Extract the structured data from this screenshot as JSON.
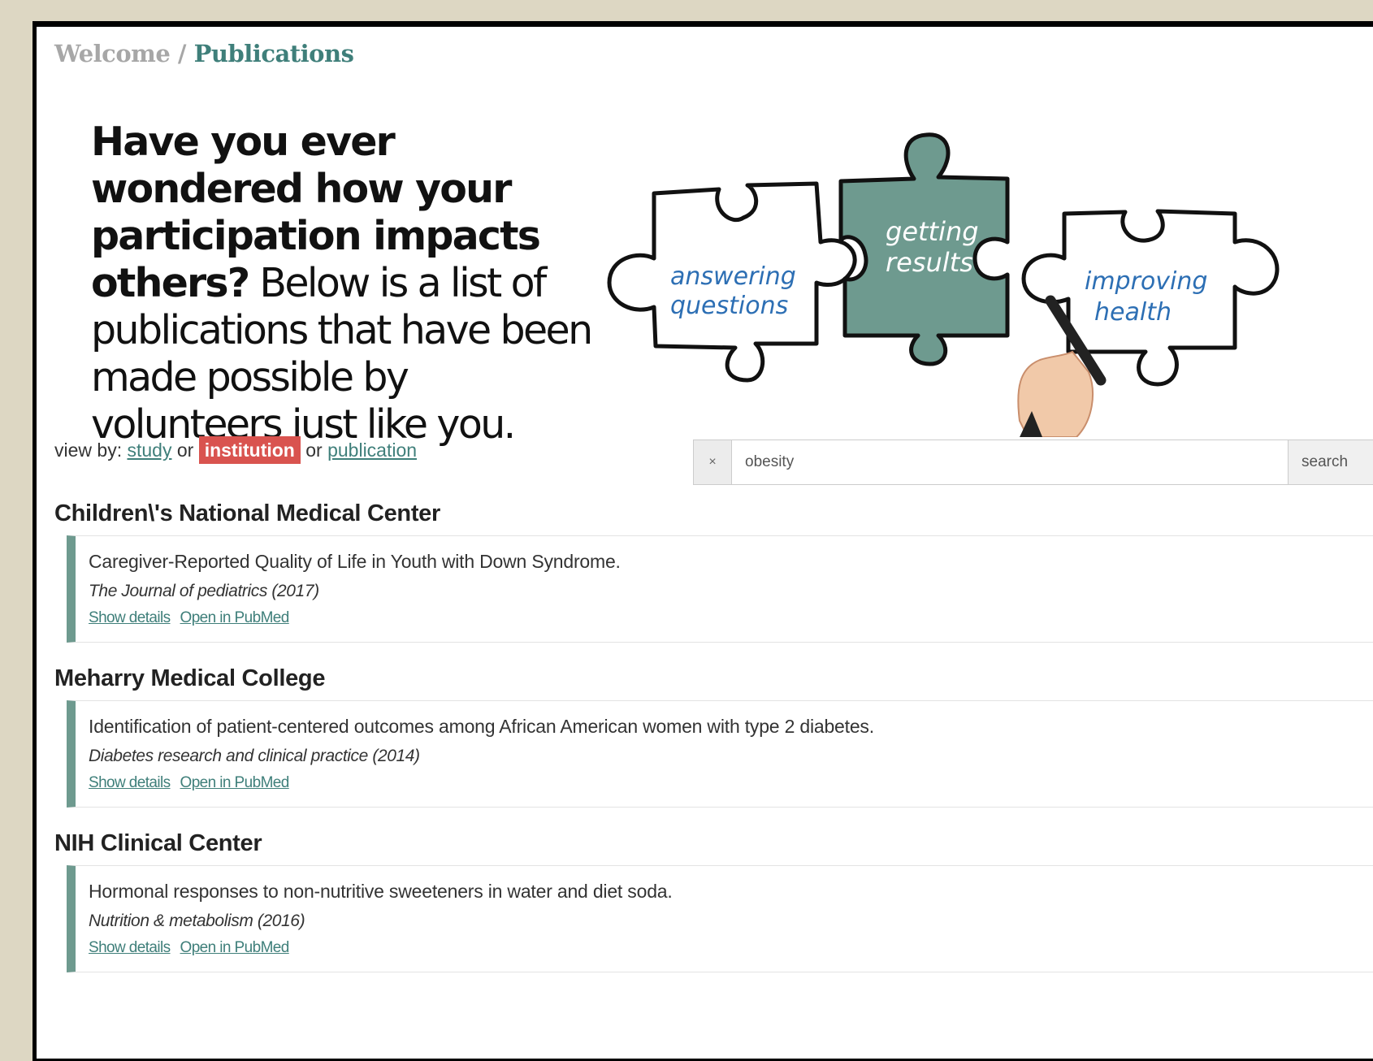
{
  "breadcrumb": {
    "home": "Welcome",
    "separator": "/",
    "current": "Publications"
  },
  "hero": {
    "bold_text": "Have you ever wondered how your participation impacts others?",
    "normal_text": " Below is a list of publications that have been made possible by volunteers just like you."
  },
  "puzzle": {
    "left_line1": "answering",
    "left_line2": "questions",
    "center_line1": "getting",
    "center_line2": "results",
    "right_line1": "improving",
    "right_line2": "health"
  },
  "view_by": {
    "prefix": "view by:",
    "option_study": "study",
    "or1": "or",
    "option_institution": "institution",
    "or2": "or",
    "option_publication": "publication",
    "active": "institution"
  },
  "search": {
    "clear_label": "×",
    "value": "obesity",
    "button_label": "search"
  },
  "groups": [
    {
      "institution": "Children\\'s National Medical Center",
      "title": "Caregiver-Reported Quality of Life in Youth with Down Syndrome.",
      "journal": "The Journal of pediatrics (2017)",
      "show_details": "Show details",
      "open_pubmed": "Open in PubMed"
    },
    {
      "institution": "Meharry Medical College",
      "title": "Identification of patient-centered outcomes among African American women with type 2 diabetes.",
      "journal": "Diabetes research and clinical practice (2014)",
      "show_details": "Show details",
      "open_pubmed": "Open in PubMed"
    },
    {
      "institution": "NIH Clinical Center",
      "title": "Hormonal responses to non-nutritive sweeteners in water and diet soda.",
      "journal": "Nutrition & metabolism (2016)",
      "show_details": "Show details",
      "open_pubmed": "Open in PubMed"
    }
  ],
  "colors": {
    "background": "#ddd7c3",
    "accent_teal": "#3f7f7a",
    "card_border": "#6e9a8f",
    "puzzle_fill": "#6e9a8f",
    "active_badge": "#d9534f",
    "puzzle_text": "#2d6fb4"
  }
}
